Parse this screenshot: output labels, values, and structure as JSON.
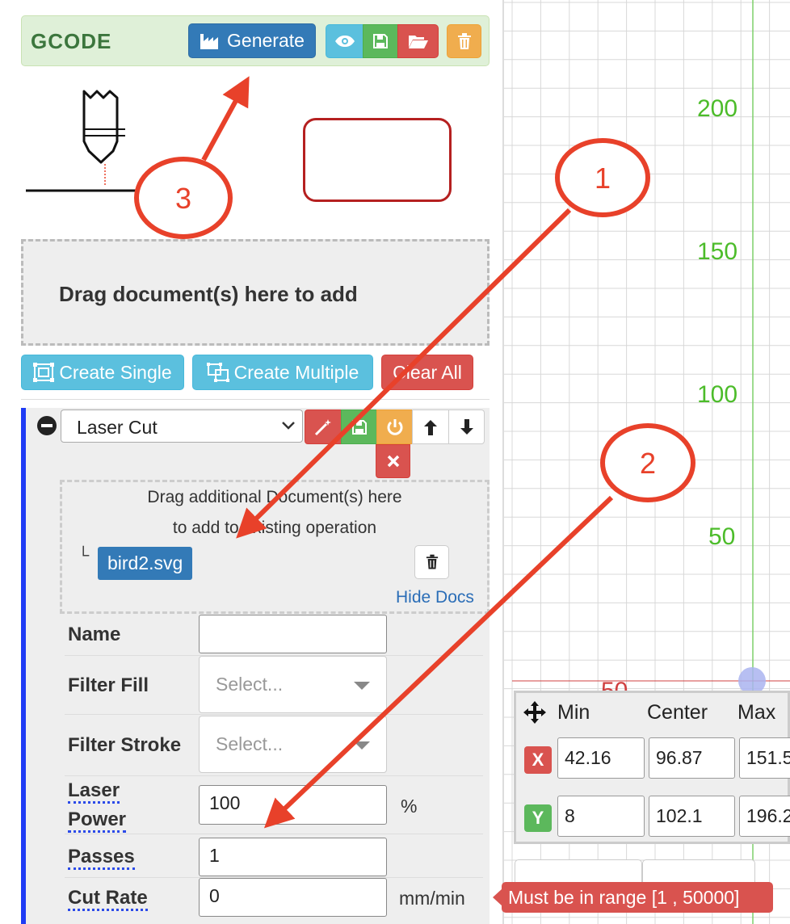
{
  "gcode": {
    "title": "GCODE",
    "generate_label": "Generate"
  },
  "dropzone": {
    "text": "Drag document(s) here to add"
  },
  "create_buttons": {
    "single": "Create Single",
    "multiple": "Create Multiple",
    "clear": "Clear All"
  },
  "operation": {
    "type_value": "Laser Cut",
    "docs_hint_line1": "Drag additional Document(s) here",
    "docs_hint_line2": "to add to existing operation",
    "doc_tree_glyph": "└",
    "doc_name": "bird2.svg",
    "hide_docs": "Hide Docs",
    "fields": {
      "name_label": "Name",
      "name_value": "",
      "filter_fill_label": "Filter Fill",
      "filter_fill_placeholder": "Select...",
      "filter_stroke_label": "Filter Stroke",
      "filter_stroke_placeholder": "Select...",
      "laser_power_label_1": "Laser",
      "laser_power_label_2": "Power",
      "laser_power_value": "100",
      "laser_power_unit": "%",
      "passes_label": "Passes",
      "passes_value": "1",
      "cut_rate_label": "Cut Rate",
      "cut_rate_value": "0",
      "cut_rate_unit": "mm/min"
    }
  },
  "canvas": {
    "y_labels": [
      "200",
      "150",
      "100",
      "50"
    ],
    "partial_label": "50"
  },
  "coords": {
    "headers": {
      "min": "Min",
      "center": "Center",
      "max": "Max"
    },
    "x_badge": "X",
    "y_badge": "Y",
    "x_min": "42.16",
    "x_center": "96.87",
    "x_max": "151.5",
    "y_min": "8",
    "y_center": "102.1",
    "y_max": "196.2"
  },
  "validation_tooltip": "Must be in range [1 , 50000]",
  "annotations": {
    "marker1": "1",
    "marker2": "2",
    "marker3": "3"
  },
  "colors": {
    "annotation_red": "#e8412a",
    "operation_border_blue": "#1f3cf5",
    "grid_label_green": "#4cbc2a"
  }
}
